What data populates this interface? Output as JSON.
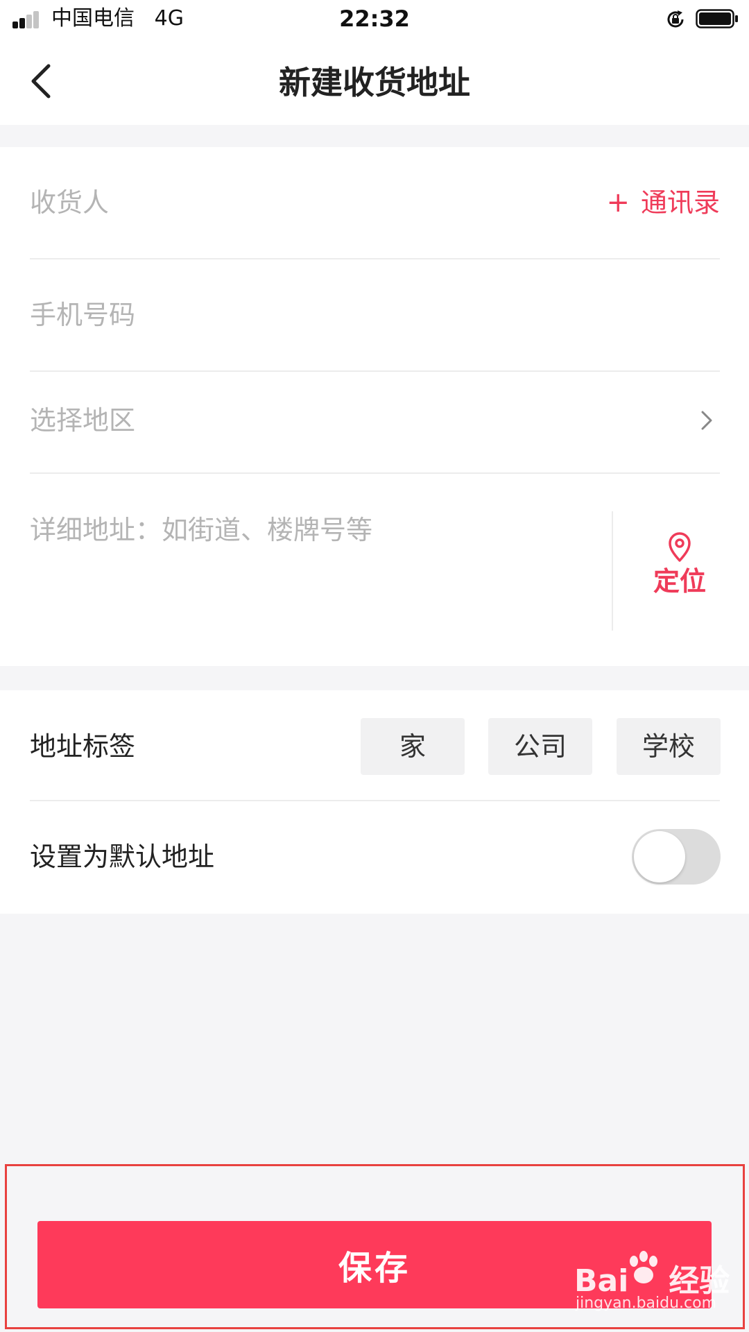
{
  "status_bar": {
    "carrier": "中国电信",
    "network": "4G",
    "time": "22:32"
  },
  "header": {
    "title": "新建收货地址"
  },
  "form": {
    "recipient_placeholder": "收货人",
    "contacts_plus": "+",
    "contacts_label": "通讯录",
    "phone_placeholder": "手机号码",
    "region_label": "选择地区",
    "detail_placeholder": "详细地址：如街道、楼牌号等",
    "locate_label": "定位"
  },
  "address_tag": {
    "label": "地址标签",
    "options": [
      "家",
      "公司",
      "学校"
    ]
  },
  "default_address": {
    "label": "设置为默认地址",
    "enabled": false
  },
  "footer": {
    "save_label": "保存"
  },
  "watermark": {
    "brand_left": "Bai",
    "brand_right": "经验",
    "url": "jingyan.baidu.com"
  },
  "colors": {
    "accent": "#ef3b59",
    "save_button": "#fe3a5a",
    "highlight_border": "#e8413f",
    "page_background": "#f5f5f7"
  },
  "icons": {
    "back": "chevron-left-icon",
    "region": "chevron-right-icon",
    "locate": "location-pin-icon",
    "status": [
      "signal-icon",
      "rotation-lock-icon",
      "battery-icon"
    ]
  }
}
